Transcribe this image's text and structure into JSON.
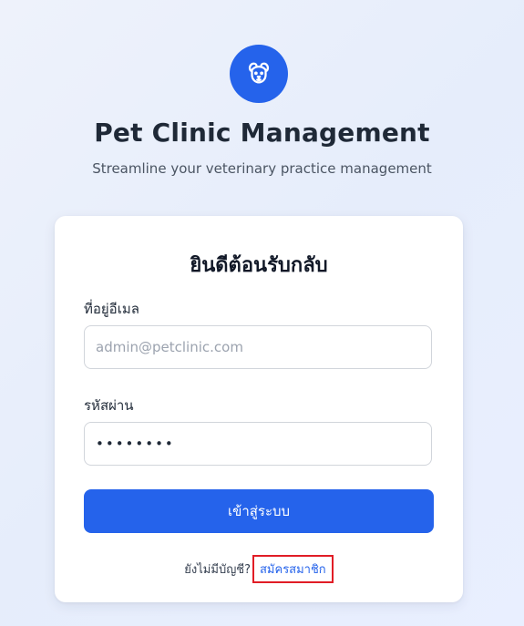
{
  "header": {
    "logo_icon": "dog-face-icon",
    "title": "Pet Clinic Management",
    "subtitle": "Streamline your veterinary practice management"
  },
  "login_card": {
    "title": "ยินดีต้อนรับกลับ",
    "email": {
      "label": "ที่อยู่อีเมล",
      "placeholder": "admin@petclinic.com",
      "value": ""
    },
    "password": {
      "label": "รหัสผ่าน",
      "value": "••••••••"
    },
    "submit_label": "เข้าสู่ระบบ",
    "signup_prompt": "ยังไม่มีบัญชี?",
    "signup_link": "สมัครสมาชิก"
  },
  "colors": {
    "accent": "#2563eb",
    "highlight_box": "#e11d26"
  }
}
